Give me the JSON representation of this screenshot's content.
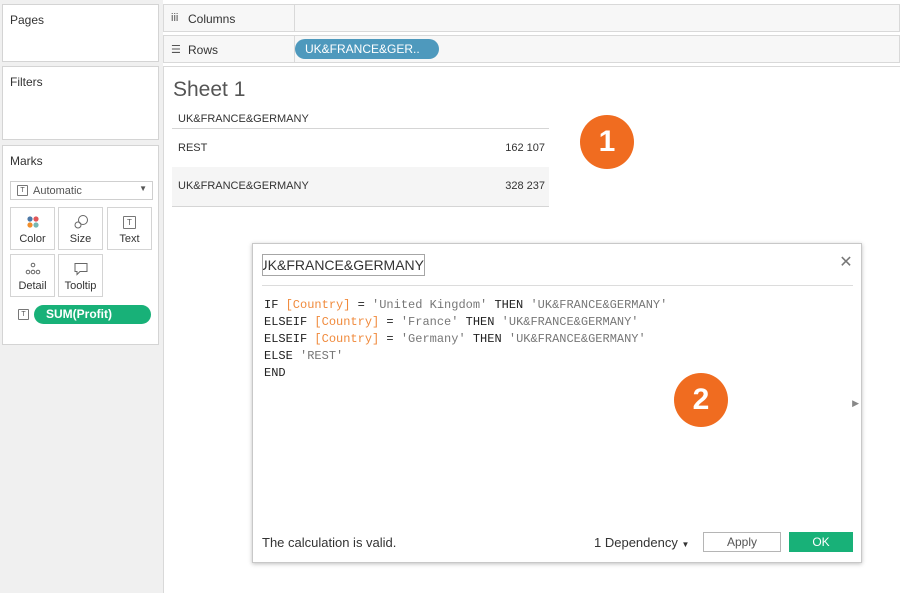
{
  "left": {
    "pages_title": "Pages",
    "filters_title": "Filters",
    "marks": {
      "title": "Marks",
      "mark_type": "Automatic",
      "cards": [
        "Color",
        "Size",
        "Text",
        "Detail",
        "Tooltip"
      ],
      "pill": "SUM(Profit)"
    }
  },
  "shelves": {
    "columns_label": "Columns",
    "rows_label": "Rows",
    "rows_pill": "UK&FRANCE&GER.."
  },
  "view": {
    "sheet_title": "Sheet 1",
    "header": "UK&FRANCE&GERMANY",
    "rows": [
      {
        "name": "REST",
        "value": "162 107"
      },
      {
        "name": "UK&FRANCE&GERMANY",
        "value": "328 237"
      }
    ]
  },
  "badges": [
    "1",
    "2"
  ],
  "dialog": {
    "calc_name": "UK&FRANCE&GERMANY",
    "code": {
      "l1": {
        "kw1": "IF ",
        "fld": "[Country]",
        "op": " = ",
        "str1": "'United Kingdom'",
        "kw2": " THEN ",
        "str2": "'UK&FRANCE&GERMANY'"
      },
      "l2": {
        "kw1": "ELSEIF ",
        "fld": "[Country]",
        "op": " = ",
        "str1": "'France'",
        "kw2": " THEN ",
        "str2": "'UK&FRANCE&GERMANY'"
      },
      "l3": {
        "kw1": "ELSEIF ",
        "fld": "[Country]",
        "op": " = ",
        "str1": "'Germany'",
        "kw2": " THEN ",
        "str2": "'UK&FRANCE&GERMANY'"
      },
      "l4": {
        "kw1": "ELSE ",
        "str1": "'REST'"
      },
      "l5": {
        "kw1": "END"
      }
    },
    "status": "The calculation is valid.",
    "dependency": "1 Dependency",
    "apply_label": "Apply",
    "ok_label": "OK"
  },
  "colors": {
    "accent_green": "#18b178",
    "pill_blue": "#4e99bd",
    "badge_orange": "#f06c20",
    "field_orange": "#f08a3c"
  }
}
